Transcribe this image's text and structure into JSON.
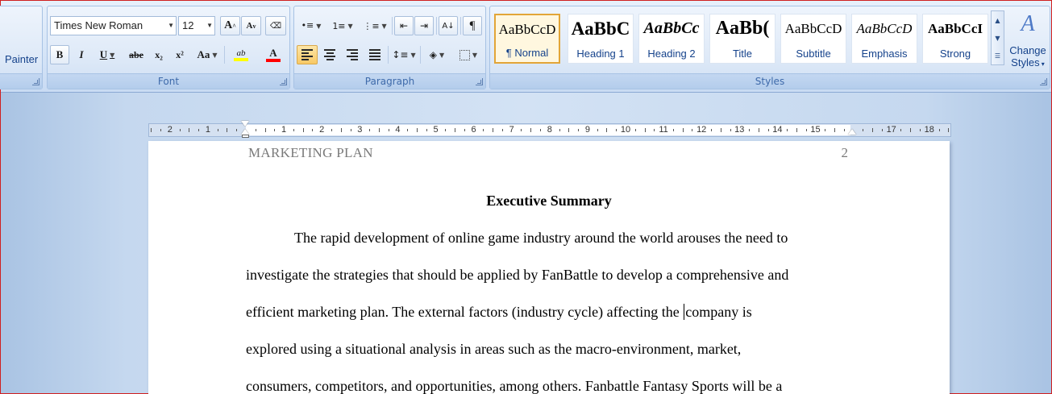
{
  "clipboard": {
    "format_painter_label": "Painter"
  },
  "font": {
    "group_label": "Font",
    "family": "Times New Roman",
    "size": "12",
    "grow_label": "A",
    "shrink_label": "A",
    "bold_label": "B",
    "italic_label": "I",
    "underline_label": "U",
    "strike_label": "abe",
    "subscript_label": "x₂",
    "superscript_label": "x²",
    "change_case_label": "Aa",
    "highlight_label": "ab",
    "font_color_label": "A",
    "highlight_color": "#ffff00",
    "font_color": "#ff0000"
  },
  "paragraph": {
    "group_label": "Paragraph",
    "show_marks_label": "¶"
  },
  "styles": {
    "group_label": "Styles",
    "items": [
      {
        "preview": "AaBbCcD",
        "name": "¶ Normal",
        "selected": true
      },
      {
        "preview": "AaBbC",
        "name": "Heading 1"
      },
      {
        "preview": "AaBbCc",
        "name": "Heading 2"
      },
      {
        "preview": "AaBb(",
        "name": "Title"
      },
      {
        "preview": "AaBbCcD",
        "name": "Subtitle"
      },
      {
        "preview": "AaBbCcD",
        "name": "Emphasis"
      },
      {
        "preview": "AaBbCcI",
        "name": "Strong"
      }
    ],
    "change_styles_line1": "Change",
    "change_styles_line2": "Styles"
  },
  "ruler": {
    "labels": [
      "2",
      "1",
      "1",
      "2",
      "3",
      "4",
      "5",
      "6",
      "7",
      "8",
      "9",
      "10",
      "11",
      "12",
      "13",
      "14",
      "15",
      "17",
      "18"
    ]
  },
  "document": {
    "running_head": "MARKETING PLAN",
    "page_number": "2",
    "heading": "Executive Summary",
    "lines": [
      "The rapid development of online game industry around the world arouses the need to",
      "investigate the strategies that should be applied by FanBattle to develop a comprehensive and",
      "efficient marketing plan. The external factors (industry cycle) affecting the ",
      "explored using a situational analysis in areas such as the macro-environment, market,",
      "consumers, competitors, and opportunities, among others. Fanbattle Fantasy Sports will be a"
    ],
    "line3_after_cursor": "company  is"
  }
}
